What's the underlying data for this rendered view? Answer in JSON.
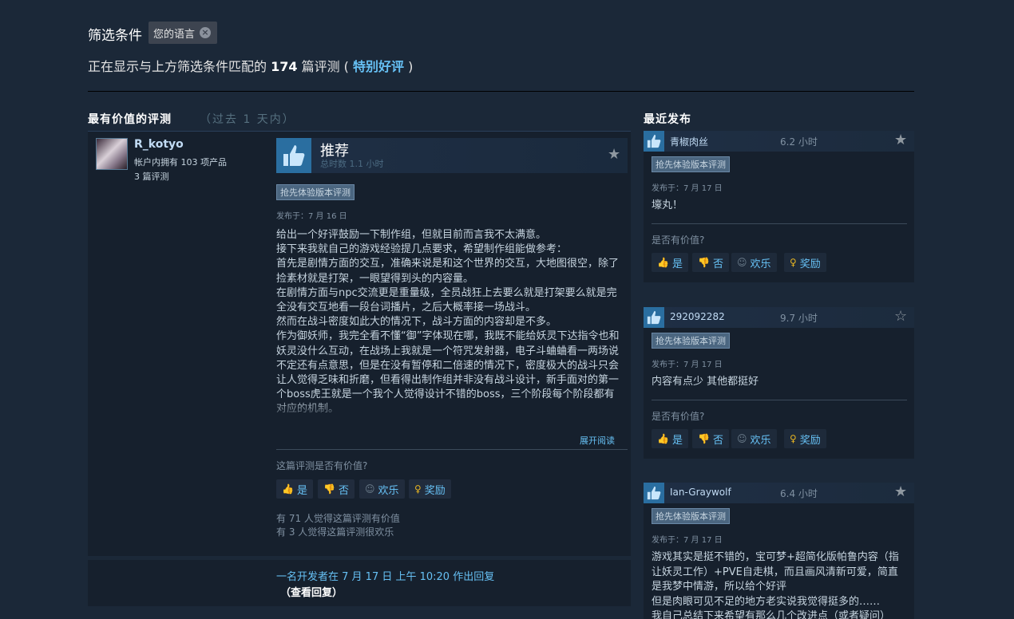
{
  "filter": {
    "label": "筛选条件",
    "chip_label": "您的语言",
    "chip_close": "×"
  },
  "matching": {
    "prefix": "正在显示与上方筛选条件匹配的 ",
    "count": "174",
    "middle": " 篇评测 ( ",
    "summary": "特别好评",
    "suffix": " )"
  },
  "most_helpful": {
    "title": "最有价值的评测",
    "subtitle": "（过去 1 天内）"
  },
  "recent": {
    "title": "最近发布"
  },
  "review": {
    "username": "R_kotyo",
    "products": "帐户内拥有 103 项产品",
    "reviews": "3 篇评测",
    "recommendation": "推荐",
    "hours": "总时数 1.1 小时",
    "tag": "抢先体验版本评测",
    "posted": "发布于：7 月 16 日",
    "text": "给出一个好评鼓励一下制作组，但就目前而言我不太满意。\n接下来我就自己的游戏经验提几点要求，希望制作组能做参考：\n首先是剧情方面的交互，准确来说是和这个世界的交互，大地图很空，除了捡素材就是打架，一眼望得到头的内容量。\n在剧情方面与npc交流更是重量级，全员战狂上去要么就是打架要么就是完全没有交互地看一段台词播片，之后大概率接一场战斗。\n然而在战斗密度如此大的情况下，战斗方面的内容却是不多。\n作为御妖师，我完全看不懂“御”字体现在哪，我既不能给妖灵下达指令也和妖灵没什么互动，在战场上我就是一个符咒发射器，电子斗蛐蛐看一两场说不定还有点意思，但是在没有暂停和二倍速的情况下，密度极大的战斗只会让人觉得乏味和折磨，但看得出制作组并非没有战斗设计，新手面对的第一个boss虎王就是一个我个人觉得设计不错的boss，三个阶段每个阶段都有对应的机制。",
    "read_more": "展开阅读",
    "helpful_question": "这篇评测是否有价值?",
    "btn_yes": "是",
    "btn_no": "否",
    "btn_funny": "欢乐",
    "btn_award": "奖励",
    "votes_helpful": "有 71 人觉得这篇评测有价值",
    "votes_funny": "有 3 人觉得这篇评测很欢乐",
    "dev_reply": "一名开发者在 7 月 17 日 上午 10:20 作出回复",
    "dev_reply_link": "（查看回复）"
  },
  "recent_reviews": [
    {
      "name": "青椒肉丝",
      "hours": "6.2 小时",
      "tag": "抢先体验版本评测",
      "posted": "发布于：7 月 17 日",
      "text": "壕丸！",
      "question": "是否有价值?",
      "btn_yes": "是",
      "btn_no": "否",
      "btn_funny": "欢乐",
      "btn_award": "奖励",
      "starred": true
    },
    {
      "name": "292092282",
      "hours": "9.7 小时",
      "tag": "抢先体验版本评测",
      "posted": "发布于：7 月 17 日",
      "text": "内容有点少 其他都挺好",
      "question": "是否有价值?",
      "btn_yes": "是",
      "btn_no": "否",
      "btn_funny": "欢乐",
      "btn_award": "奖励",
      "starred": false
    },
    {
      "name": "Ian-Graywolf",
      "hours": "6.4 小时",
      "tag": "抢先体验版本评测",
      "posted": "发布于：7 月 17 日",
      "text": "游戏其实是挺不错的，宝可梦+超简化版帕鲁内容（指让妖灵工作）+PVE自走棋，而且画风清新可爱，简直是我梦中情游，所以给个好评\n但是肉眼可见不足的地方老实说我觉得挺多的……\n我自己总结下来希望有那么几个改进点（或者疑问）",
      "starred": true
    }
  ],
  "colors": {
    "background": "#1b2838",
    "accent": "#66c0f4",
    "thumb": "#2a6ea0",
    "award": "#e6b422"
  }
}
